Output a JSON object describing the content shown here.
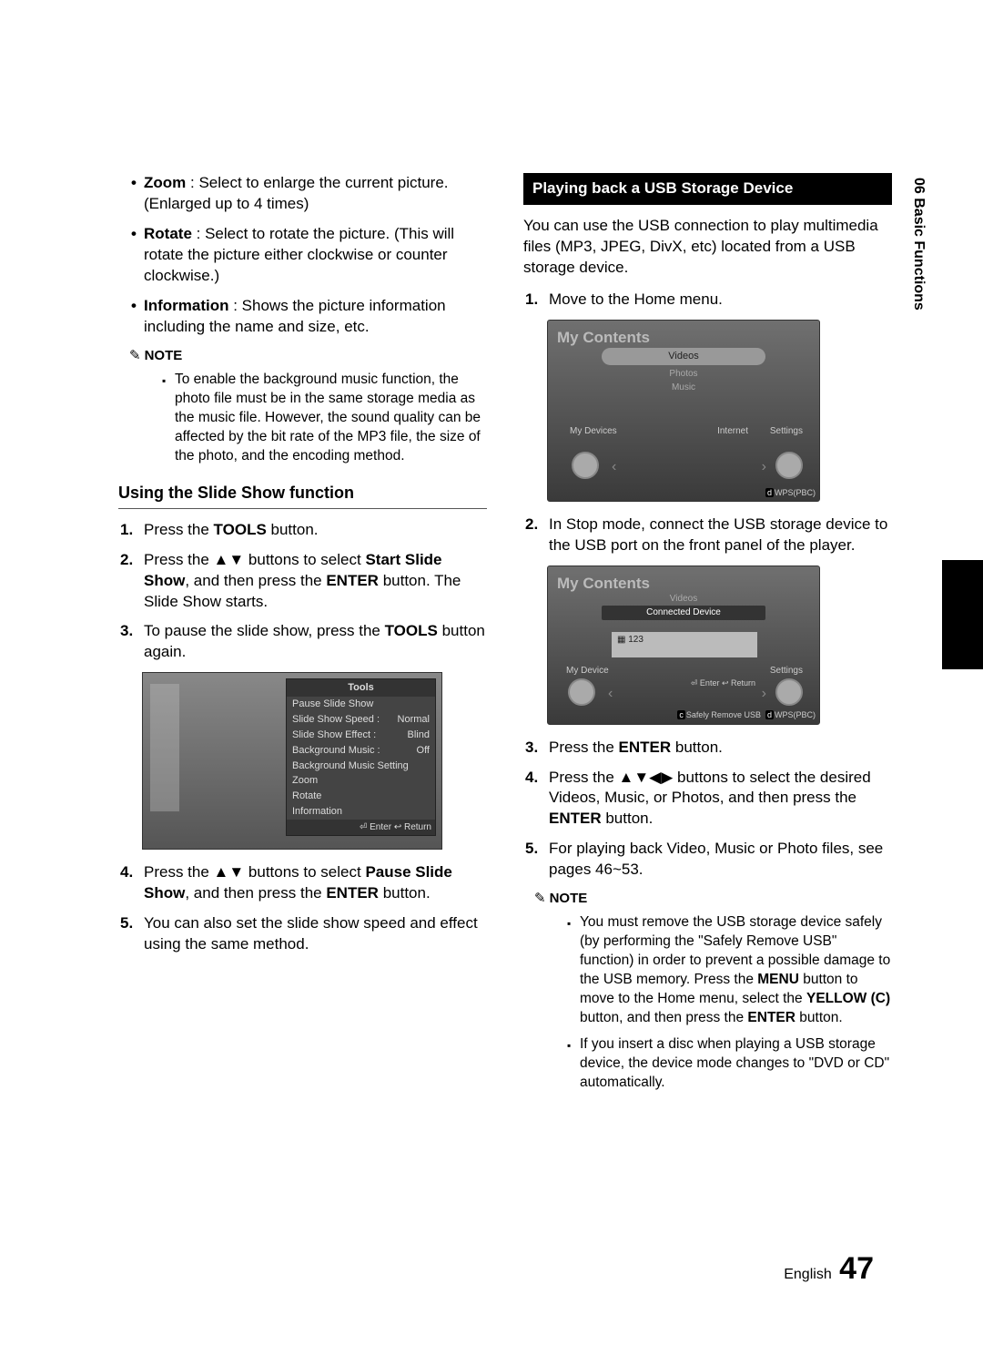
{
  "sideTab": "06   Basic Functions",
  "footer": {
    "lang": "English",
    "page": "47"
  },
  "left": {
    "bullets": [
      {
        "label": "Zoom",
        "text": " : Select to enlarge the current picture. (Enlarged up to 4 times)"
      },
      {
        "label": "Rotate",
        "text": " : Select to rotate the picture. (This will rotate the picture either clockwise or counter clockwise.)"
      },
      {
        "label": "Information",
        "text": " : Shows the picture information including the name and size, etc."
      }
    ],
    "noteLabel": "NOTE",
    "note1": "To enable the background music function, the photo file must be in the same storage media as the music file. However, the sound quality can be affected by the bit rate of the MP3 file, the size of the photo, and the encoding method.",
    "subheading": "Using the Slide Show function",
    "step1a": "Press the ",
    "step1b": "TOOLS",
    "step1c": " button.",
    "step2a": "Press the ▲▼ buttons to select ",
    "step2b": "Start Slide Show",
    "step2c": ", and then press the ",
    "step2d": "ENTER",
    "step2e": " button. The Slide Show starts.",
    "step3a": "To pause the slide show, press the ",
    "step3b": "TOOLS",
    "step3c": " button again.",
    "step4a": "Press the ▲▼ buttons to select ",
    "step4b": "Pause Slide Show",
    "step4c": ", and then press the ",
    "step4d": "ENTER",
    "step4e": " button.",
    "step5": "You can also set the slide show speed and effect using the same method.",
    "tools": {
      "title": "Tools",
      "rows": [
        [
          "Pause Slide Show",
          ""
        ],
        [
          "Slide Show Speed   :",
          "Normal"
        ],
        [
          "Slide Show Effect   :",
          "Blind"
        ],
        [
          "Background Music  :",
          "Off"
        ],
        [
          "Background Music Setting",
          ""
        ],
        [
          "Zoom",
          ""
        ],
        [
          "Rotate",
          ""
        ],
        [
          "Information",
          ""
        ]
      ],
      "footer": "⏎ Enter   ↩ Return"
    }
  },
  "right": {
    "banner": "Playing back a USB Storage Device",
    "intro": "You can use the USB connection to play multimedia files (MP3, JPEG, DivX, etc) located from a USB storage device.",
    "step1": "Move to the Home menu.",
    "step2": "In Stop mode, connect the USB storage device to the USB port on the front panel of the player.",
    "step3a": "Press the ",
    "step3b": "ENTER",
    "step3c": " button.",
    "step4a": "Press the ▲▼◀▶ buttons to select the desired Videos, Music, or Photos, and then press the ",
    "step4b": "ENTER",
    "step4c": " button.",
    "step5": "For playing back Video, Music or Photo files, see pages 46~53.",
    "noteLabel": "NOTE",
    "noteItems": {
      "n1a": "You must remove the USB storage device safely (by performing the \"Safely Remove USB\" function) in order to prevent a possible damage to the USB memory. Press the ",
      "n1b": "MENU",
      "n1c": " button to move to the Home menu, select the ",
      "n1d": "YELLOW (C)",
      "n1e": " button, and then press the ",
      "n1f": "ENTER",
      "n1g": " button.",
      "n2": "If you insert a disc when playing a USB storage device, the device mode changes to \"DVD or CD\" automatically."
    },
    "shot1": {
      "title": "My Contents",
      "videos": "Videos",
      "photos": "Photos",
      "music": "Music",
      "myDevices": "My Devices",
      "internet": "Internet",
      "settings": "Settings",
      "wps": "WPS(PBC)",
      "d": "d"
    },
    "shot2": {
      "title": "My Contents",
      "videos": "Videos",
      "connected": "Connected Device",
      "id": "123",
      "myDevice": "My Device",
      "settings": "Settings",
      "enterReturn": "⏎ Enter   ↩ Return",
      "safely": "Safely Remove USB",
      "c": "c",
      "wps": "WPS(PBC)",
      "d": "d"
    }
  }
}
